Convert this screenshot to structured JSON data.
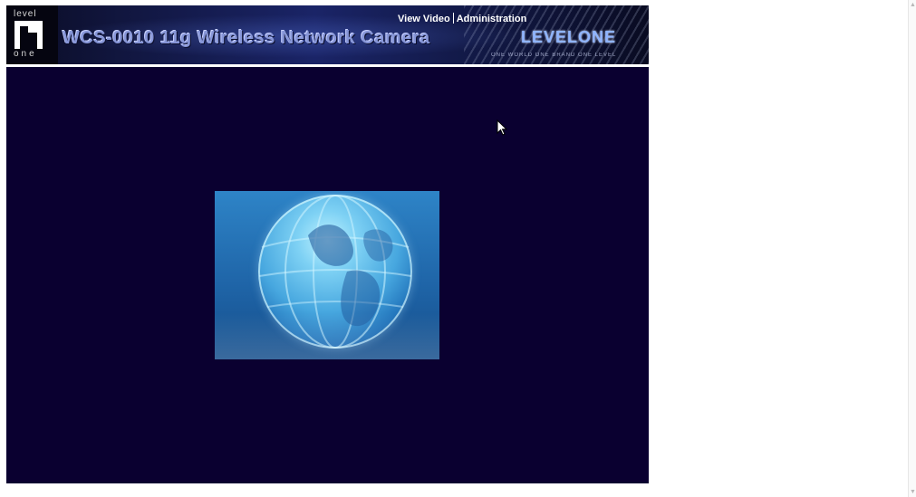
{
  "header": {
    "product_title": "WCS-0010 11g Wireless Network Camera",
    "logo_top": "level",
    "logo_bottom": "one",
    "brand_name": "LEVELONE",
    "brand_tagline": "ONE WORLD ONE BRAND ONE LEVEL"
  },
  "nav": {
    "view_video": "View Video",
    "administration": "Administration"
  },
  "colors": {
    "video_background": "#0a0030",
    "banner_blue": "#1a2467",
    "link_text": "#ffffff"
  },
  "icons": {
    "logo": "levelone-logo-icon",
    "globe": "globe-image",
    "cursor": "mouse-pointer-icon",
    "scroll_up": "scroll-up-arrow-icon",
    "scroll_down": "scroll-down-arrow-icon"
  }
}
